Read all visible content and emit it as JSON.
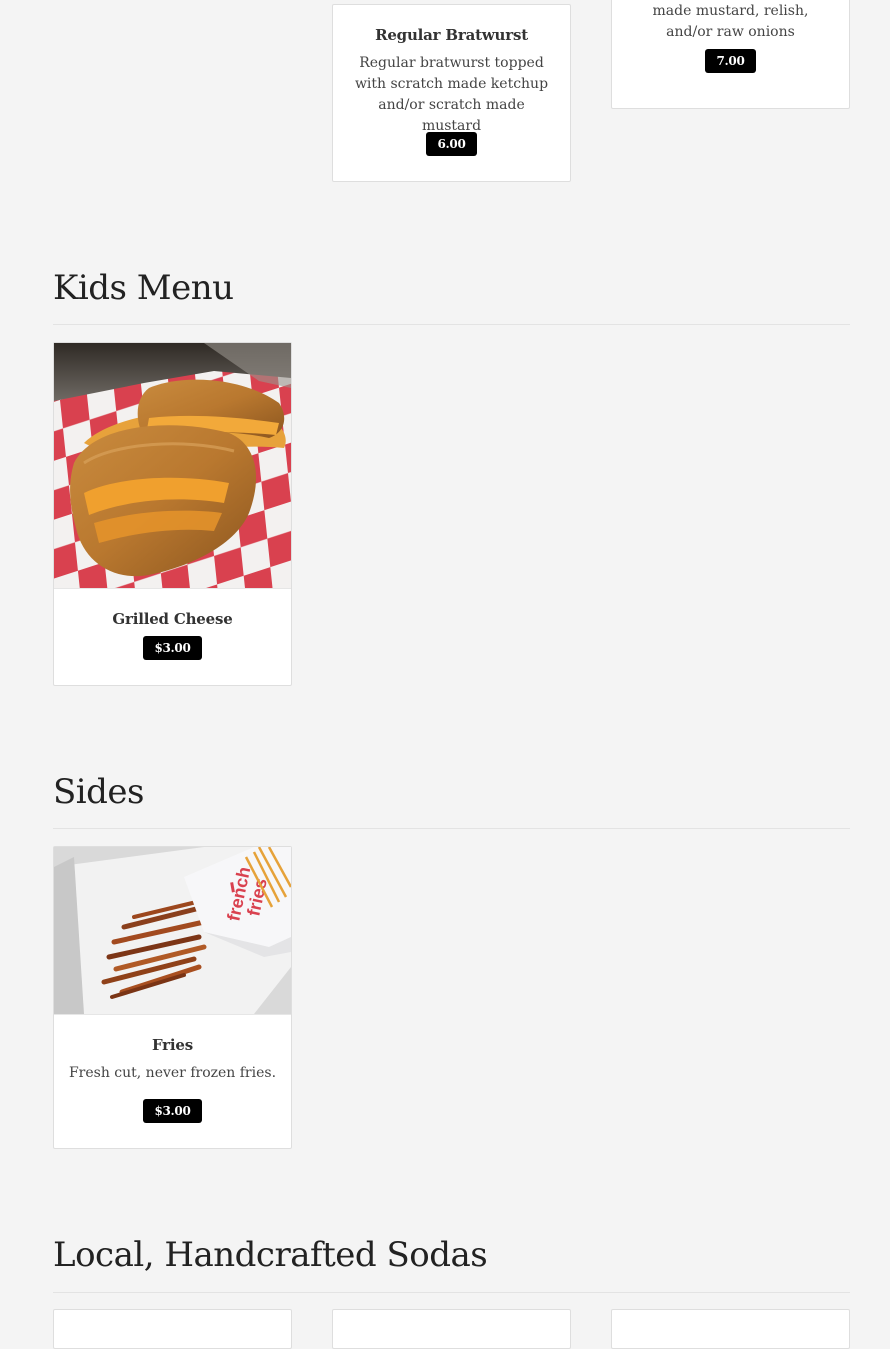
{
  "partial_item": {
    "desc": "made mustard, relish, and/or raw onions",
    "price": "7.00"
  },
  "brat_item": {
    "title": "Regular Bratwurst",
    "desc": "Regular bratwurst topped with scratch made ketchup and/or scratch made mustard",
    "price": "6.00"
  },
  "kids": {
    "heading": "Kids Menu",
    "item": {
      "title": "Grilled Cheese",
      "price": "$3.00",
      "image": "grilled-cheese-photo"
    }
  },
  "sides": {
    "heading": "Sides",
    "item": {
      "title": "Fries",
      "desc": "Fresh cut, never frozen fries.",
      "price": "$3.00",
      "image": "fries-photo"
    }
  },
  "sodas": {
    "heading": "Local, Handcrafted Sodas"
  }
}
